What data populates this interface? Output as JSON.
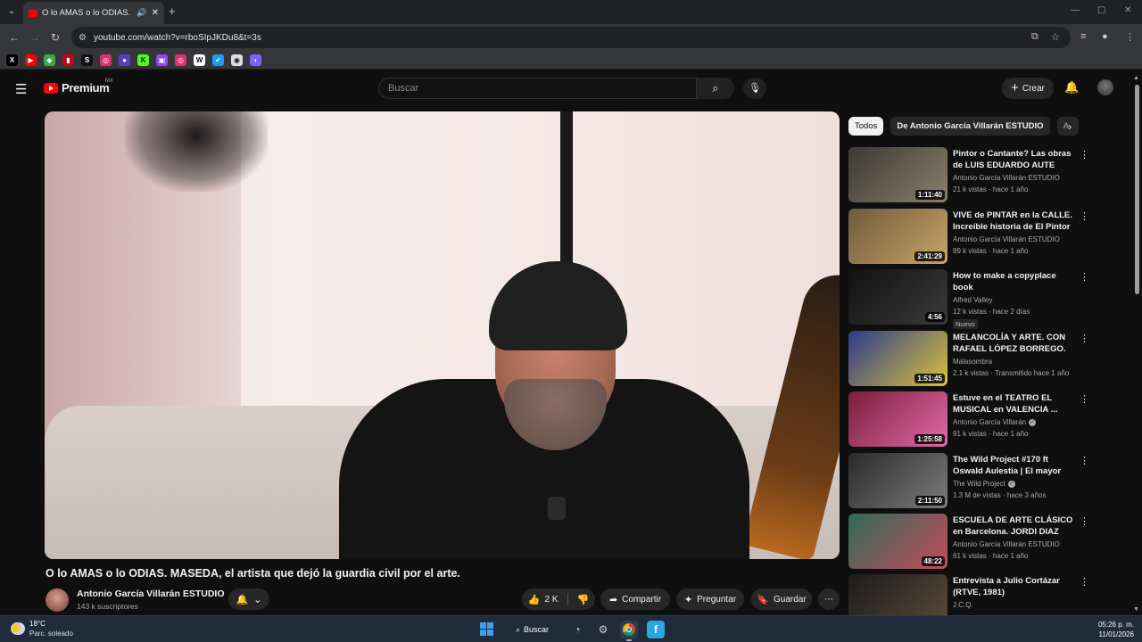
{
  "browser": {
    "tab_title": "O lo AMAS o lo ODIAS. MA",
    "url": "youtube.com/watch?v=rboSIpJKDu8&t=3s",
    "bookmarks": [
      {
        "glyph": "X",
        "color": "#000000"
      },
      {
        "glyph": "▶",
        "color": "#ff0000"
      },
      {
        "glyph": "◆",
        "color": "#3aa845"
      },
      {
        "glyph": "▮",
        "color": "#c4001a"
      },
      {
        "glyph": "S",
        "color": "#111111"
      },
      {
        "glyph": "◎",
        "color": "#e1306c"
      },
      {
        "glyph": "●",
        "color": "#5b3cc4"
      },
      {
        "glyph": "K",
        "color": "#53fc18"
      },
      {
        "glyph": "▣",
        "color": "#9146ff"
      },
      {
        "glyph": "◎",
        "color": "#e1306c"
      },
      {
        "glyph": "W",
        "color": "#ffffff"
      },
      {
        "glyph": "✔",
        "color": "#1d9bf0"
      },
      {
        "glyph": "◉",
        "color": "#dddddd"
      },
      {
        "glyph": "◗",
        "color": "#7b61ff"
      }
    ]
  },
  "youtube": {
    "logo_text": "Premium",
    "country_code": "MX",
    "search_placeholder": "Buscar",
    "create_label": "Crear"
  },
  "video": {
    "title": "O lo AMAS o lo ODIAS. MASEDA, el artista que dejó la guardia civil por el arte.",
    "channel_name": "Antonio García Villarán ESTUDIO",
    "subscribers": "143 k suscriptores",
    "likes": "2 K",
    "share_label": "Compartir",
    "ask_label": "Preguntar",
    "save_label": "Guardar"
  },
  "chips": [
    "Todos",
    "De Antonio García Villarán ESTUDIO",
    "A"
  ],
  "recommendations": [
    {
      "title": "Pintor o Cantante? Las obras de LUIS EDUARDO AUTE contada...",
      "channel": "Antonio García Villarán ESTUDIO",
      "meta": "21 k vistas · hace 1 año",
      "duration": "1:11:40",
      "thumb_colors": [
        "#3b3a34",
        "#8b7f6a"
      ],
      "verified": false,
      "badge": ""
    },
    {
      "title": "VIVE de PINTAR en la CALLE. Increíble historia de El Pintor ...",
      "channel": "Antonio García Villarán ESTUDIO",
      "meta": "89 k vistas · hace 1 año",
      "duration": "2:41:29",
      "thumb_colors": [
        "#6e5a3c",
        "#c9a466"
      ],
      "verified": false,
      "badge": ""
    },
    {
      "title": "How to make a copyplace book",
      "channel": "Alfred Valley",
      "meta": "12 k vistas · hace 2 días",
      "duration": "4:56",
      "thumb_colors": [
        "#111111",
        "#3a3a3a"
      ],
      "verified": false,
      "badge": "Nuevo"
    },
    {
      "title": "MELANCOLÍA Y ARTE. CON RAFAEL LÓPEZ BORREGO.",
      "channel": "Malasombra",
      "meta": "2.1 k vistas · Transmitido hace 1 año",
      "duration": "1:51:45",
      "thumb_colors": [
        "#2d3a8c",
        "#d9c23a"
      ],
      "verified": false,
      "badge": ""
    },
    {
      "title": "Estuve en el TEATRO EL MUSICAL en VALENCIA ...",
      "channel": "Antonio García Villarán",
      "meta": "91 k vistas · hace 1 año",
      "duration": "1:25:58",
      "thumb_colors": [
        "#7a1e3a",
        "#e06aa8"
      ],
      "verified": true,
      "badge": ""
    },
    {
      "title": "The Wild Project #170 ft Oswald Aulestia | El mayor falsificador...",
      "channel": "The Wild Project",
      "meta": "1.3 M de vistas · hace 3 años",
      "duration": "2:11:50",
      "thumb_colors": [
        "#2a2a2a",
        "#7c7c7c"
      ],
      "verified": true,
      "badge": ""
    },
    {
      "title": "ESCUELA DE ARTE CLÁSICO en Barcelona. JORDI DIAZ ALAM...",
      "channel": "Antonio García Villarán ESTUDIO",
      "meta": "61 k vistas · hace 1 año",
      "duration": "48:22",
      "thumb_colors": [
        "#2f6b5a",
        "#c44b5b"
      ],
      "verified": false,
      "badge": ""
    },
    {
      "title": "Entrevista a Julio Cortázar (RTVE, 1981)",
      "channel": "J.C.Q.",
      "meta": "",
      "duration": "",
      "thumb_colors": [
        "#1c1c1c",
        "#5c4a3a"
      ],
      "verified": false,
      "badge": ""
    }
  ],
  "taskbar": {
    "temperature": "18°C",
    "weather": "Parc. soleado",
    "search_label": "Buscar",
    "time": "05:26 p. m.",
    "date": "11/01/2026"
  }
}
